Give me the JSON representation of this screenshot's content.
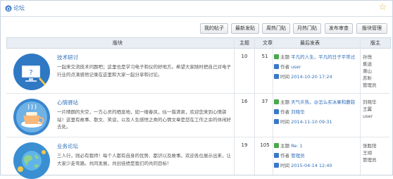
{
  "top": {
    "title": "论坛",
    "star_icon": "star-icon"
  },
  "toolbar": {
    "my_posts": "我的帖子",
    "latest": "最新发贴",
    "weekly_hot": "周热门贴",
    "monthly_hot": "月热门贴",
    "review": "发布审查",
    "manage": "版块管理"
  },
  "table": {
    "headers": {
      "board": "版块",
      "topics": "主题",
      "posts": "文章",
      "latest": "最后发表",
      "mods": "版主"
    },
    "rows": [
      {
        "name": "技术研讨",
        "desc": "一起来交流技术问题吧；这里也是学习电子和仪的好地方。希望大家随时把自己对电子行业的点滴感悟记录在这里和大家一起分享和讨论。",
        "topics": "10",
        "posts": "51",
        "last": {
          "subject_label": "主题",
          "subject": "平凡的人生，平凡的日子平常过",
          "author_label": "作者",
          "author": "user",
          "time_label": "时间",
          "time": "2014-10-20 17:24"
        },
        "mods": [
          "孙悦",
          "蕉迪",
          "萧山",
          "苏昕",
          "管理员"
        ]
      },
      {
        "name": "心情驿站",
        "desc": "一片晴朗的天空，一方心灵的栖息地，如一缕春风，似一翦清泉，欢迎您来到心情驿站！这里有故事、散文、笑谈，以及人生感悟之类的心情文章是您在工作之余的休闲好去处。",
        "topics": "16",
        "posts": "37",
        "last": {
          "subject_label": "主题",
          "subject": "天气炎热，@怎么买冰果和蘑菇",
          "author_label": "作者",
          "author": "刘晓华",
          "time_label": "时间",
          "time": "2014-11-10 09:31"
        },
        "mods": [
          "刘晓华",
          "王翼",
          "user"
        ]
      },
      {
        "name": "业务论坛",
        "desc": "三人行，则必有我师！每个人都有自身的优势、都识以及故事。欢迎各位展示出来，让大家少走弯路。共同发展，共创佳绩是我们的共同目标！",
        "topics": "19",
        "posts": "105",
        "last": {
          "subject_label": "主题",
          "subject": "Re: 1",
          "author_label": "作者",
          "author": "管理员",
          "time_label": "时间",
          "time": "2015-04-14 12:40"
        },
        "mods": [
          "张胜阳",
          "王翊",
          "管理员"
        ]
      }
    ]
  }
}
